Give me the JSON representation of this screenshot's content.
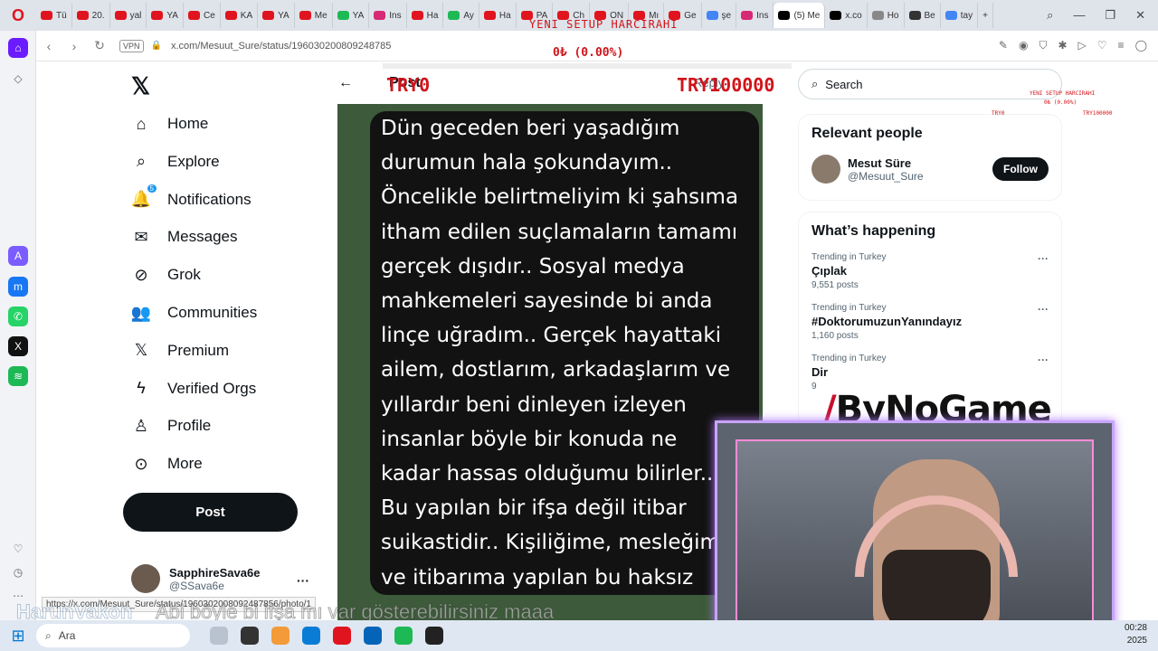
{
  "browser": {
    "tabs": [
      {
        "label": "Tü",
        "color": "#e0141e"
      },
      {
        "label": "20.",
        "color": "#e0141e"
      },
      {
        "label": "yal",
        "color": "#e0141e"
      },
      {
        "label": "YA",
        "color": "#e0141e"
      },
      {
        "label": "Ce",
        "color": "#e0141e"
      },
      {
        "label": "KA",
        "color": "#e0141e"
      },
      {
        "label": "YA",
        "color": "#e0141e"
      },
      {
        "label": "Me",
        "color": "#e0141e"
      },
      {
        "label": "YA",
        "color": "#1db954"
      },
      {
        "label": "Ins",
        "color": "#d62976"
      },
      {
        "label": "Ha",
        "color": "#e0141e"
      },
      {
        "label": "Ay",
        "color": "#1db954"
      },
      {
        "label": "Ha",
        "color": "#e0141e"
      },
      {
        "label": "PA",
        "color": "#e0141e"
      },
      {
        "label": "Ch",
        "color": "#e0141e"
      },
      {
        "label": "ON",
        "color": "#e0141e"
      },
      {
        "label": "Mı",
        "color": "#e0141e"
      },
      {
        "label": "Ge",
        "color": "#e0141e"
      },
      {
        "label": "şe",
        "color": "#4285f4"
      },
      {
        "label": "Ins",
        "color": "#d62976"
      },
      {
        "label": "(5) Me",
        "color": "#000000",
        "active": true
      },
      {
        "label": "x.co",
        "color": "#000000"
      },
      {
        "label": "Ho",
        "color": "#888888"
      },
      {
        "label": "Be",
        "color": "#333333"
      },
      {
        "label": "tay",
        "color": "#4285f4"
      }
    ],
    "new_tab": "+",
    "url": "x.com/Mesuut_Sure/status/196030200809248785",
    "vpn_label": "VPN"
  },
  "stream_overlay": {
    "title": "YENI SETUP HARCIRAHI",
    "percent": "0₺ (0.00%)",
    "progress": 0,
    "min_label": "TRY0",
    "max_label": "TRY100000",
    "mini_title": "YENI SETUP HARCIRAHI",
    "mini_percent": "0₺ (0.00%)",
    "mini_min": "TRY0",
    "mini_max": "TRY100000",
    "brand": "ByNoGame",
    "chat_name": "HarunVakon",
    "chat_msg": "Abi böyle bi ifşa mı var gösterebilirsiniz maaa"
  },
  "sidebar": {
    "items": [
      {
        "label": "Home",
        "icon": "home-icon"
      },
      {
        "label": "Explore",
        "icon": "search-icon"
      },
      {
        "label": "Notifications",
        "icon": "bell-icon",
        "badge": "5"
      },
      {
        "label": "Messages",
        "icon": "mail-icon"
      },
      {
        "label": "Grok",
        "icon": "grok-icon"
      },
      {
        "label": "Communities",
        "icon": "communities-icon"
      },
      {
        "label": "Premium",
        "icon": "x-icon"
      },
      {
        "label": "Verified Orgs",
        "icon": "bolt-icon"
      },
      {
        "label": "Profile",
        "icon": "person-icon"
      },
      {
        "label": "More",
        "icon": "more-icon"
      }
    ],
    "post_button": "Post",
    "account": {
      "name": "SapphireSava6e",
      "handle": "@SSava6e"
    }
  },
  "post": {
    "header": "Post",
    "reply_label": "Reply",
    "image_text": [
      "Dün geceden beri yaşadığım",
      "durumun hala şokundayım..",
      "Öncelikle belirtmeliyim ki şahsıma",
      "itham edilen suçlamaların tamamı",
      "gerçek dışıdır.. Sosyal medya",
      "mahkemeleri sayesinde bi anda",
      "linçe uğradım.. Gerçek hayattaki",
      "ailem, dostlarım, arkadaşlarım ve",
      "yıllardır beni dinleyen izleyen",
      "insanlar böyle bir konuda ne",
      "kadar hassas olduğumu bilirler..",
      "Bu yapılan bir ifşa değil itibar",
      "suikastidir.. Kişiliğime, mesleğime",
      "ve itibarıma yapılan bu haksız"
    ]
  },
  "right": {
    "search_placeholder": "Search",
    "relevant_title": "Relevant people",
    "person": {
      "name": "Mesut Süre",
      "handle": "@Mesuut_Sure",
      "follow": "Follow"
    },
    "happening_title": "What’s happening",
    "trends": [
      {
        "context": "Trending in Turkey",
        "name": "Çıplak",
        "count": "9,551 posts"
      },
      {
        "context": "Trending in Turkey",
        "name": "#DoktorumuzunYanındayız",
        "count": "1,160 posts"
      },
      {
        "context": "Trending in Turkey",
        "name": "Dir",
        "count": "9"
      }
    ]
  },
  "status_bar_url": "https://x.com/Mesuut_Sure/status/1960302008092487856/photo/1",
  "taskbar": {
    "search_placeholder": "Ara",
    "time": "00:28",
    "date": "2025"
  }
}
